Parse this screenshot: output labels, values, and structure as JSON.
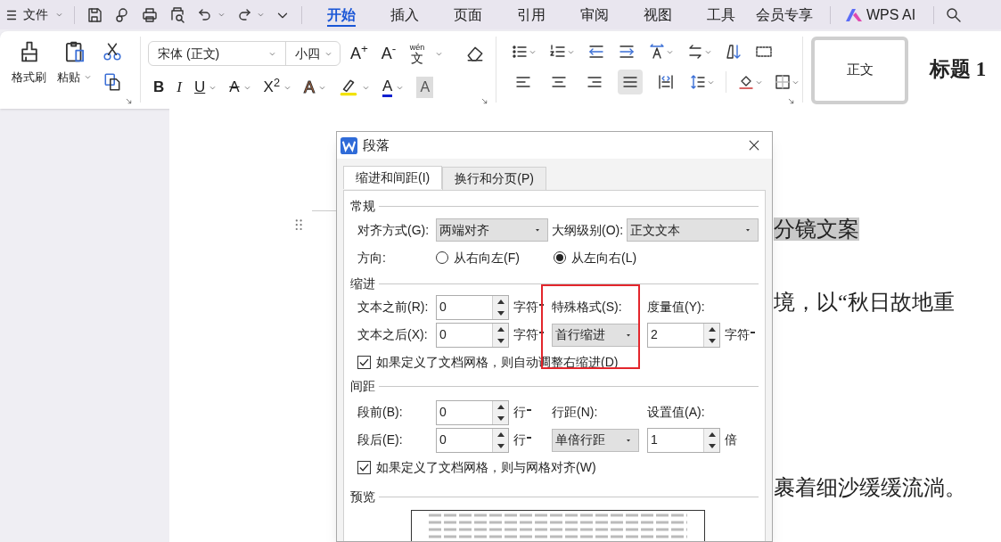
{
  "menu_bar": {
    "file_menu": "文件",
    "tabs": [
      {
        "label": "开始",
        "selected": true
      },
      {
        "label": "插入",
        "selected": false
      },
      {
        "label": "页面",
        "selected": false
      },
      {
        "label": "引用",
        "selected": false
      },
      {
        "label": "审阅",
        "selected": false
      },
      {
        "label": "视图",
        "selected": false
      },
      {
        "label": "工具",
        "selected": false
      },
      {
        "label": "会员专享",
        "selected": false
      }
    ],
    "ai_button": "WPS AI"
  },
  "ribbon": {
    "format_painter": "格式刷",
    "paste": "粘贴",
    "font_name": "宋体 (正文)",
    "font_size": "小四",
    "size_buttons": [
      "A$^{+}$",
      "A$^{-}$"
    ],
    "phonetic": {
      "ruby": "wén",
      "char": "文"
    },
    "format_buttons": [
      {
        "kind": "bold",
        "glyph": "B"
      },
      {
        "kind": "italic",
        "glyph": "I"
      },
      {
        "kind": "underline",
        "glyph": "U"
      },
      {
        "kind": "strike",
        "glyph": "A"
      },
      {
        "kind": "superscript",
        "glyph": "X$^{2}$"
      },
      {
        "kind": "effect",
        "glyph": "A"
      },
      {
        "kind": "highlight"
      },
      {
        "kind": "color",
        "glyph": "A"
      },
      {
        "kind": "shading",
        "glyph": "A"
      }
    ],
    "align_buttons": [
      {
        "kind": "left",
        "selected": false
      },
      {
        "kind": "center",
        "selected": false
      },
      {
        "kind": "right",
        "selected": false
      },
      {
        "kind": "justify",
        "selected": true
      },
      {
        "kind": "distribute",
        "selected": false
      }
    ],
    "styles": [
      {
        "label": "正文",
        "selected": true
      },
      {
        "label": "标题 1",
        "selected": false
      }
    ]
  },
  "document": {
    "lines": [
      {
        "text": "分镜文案",
        "highlighted": true
      },
      {
        "text": "境，以“秋日故地重",
        "highlighted": false
      },
      {
        "text": "裹着细沙缓缓流淌。",
        "highlighted": false
      }
    ]
  },
  "dialog": {
    "title": "段落",
    "tabs": [
      {
        "label": "缩进和间距(I)",
        "selected": true
      },
      {
        "label": "换行和分页(P)",
        "selected": false
      }
    ],
    "general": {
      "title": "常规",
      "alignment_label": "对齐方式(G):",
      "alignment_value": "两端对齐",
      "outline_label": "大纲级别(O):",
      "outline_value": "正文文本",
      "direction_label": "方向:",
      "directions": [
        {
          "label": "从右向左(F)",
          "selected": false
        },
        {
          "label": "从左向右(L)",
          "selected": true
        }
      ]
    },
    "indent": {
      "title": "缩进",
      "rows": [
        {
          "label": "文本之前(R):",
          "value": "0",
          "unit": "字符"
        },
        {
          "label": "文本之后(X):",
          "value": "0",
          "unit": "字符"
        }
      ],
      "special_label": "特殊格式(S):",
      "special_value": "首行缩进",
      "measure_label": "度量值(Y):",
      "measure_value": "2",
      "measure_unit": "字符",
      "grid_check": {
        "label": "如果定义了文档网格，则自动调整右缩进(D)",
        "checked": true
      }
    },
    "spacing": {
      "title": "间距",
      "rows": [
        {
          "label": "段前(B):",
          "value": "0",
          "unit": "行"
        },
        {
          "label": "段后(E):",
          "value": "0",
          "unit": "行"
        }
      ],
      "line_label": "行距(N):",
      "line_value": "单倍行距",
      "set_label": "设置值(A):",
      "set_value": "1",
      "set_unit": "倍",
      "grid_check": {
        "label": "如果定义了文档网格，则与网格对齐(W)",
        "checked": true
      }
    },
    "preview": {
      "title": "预览"
    }
  }
}
